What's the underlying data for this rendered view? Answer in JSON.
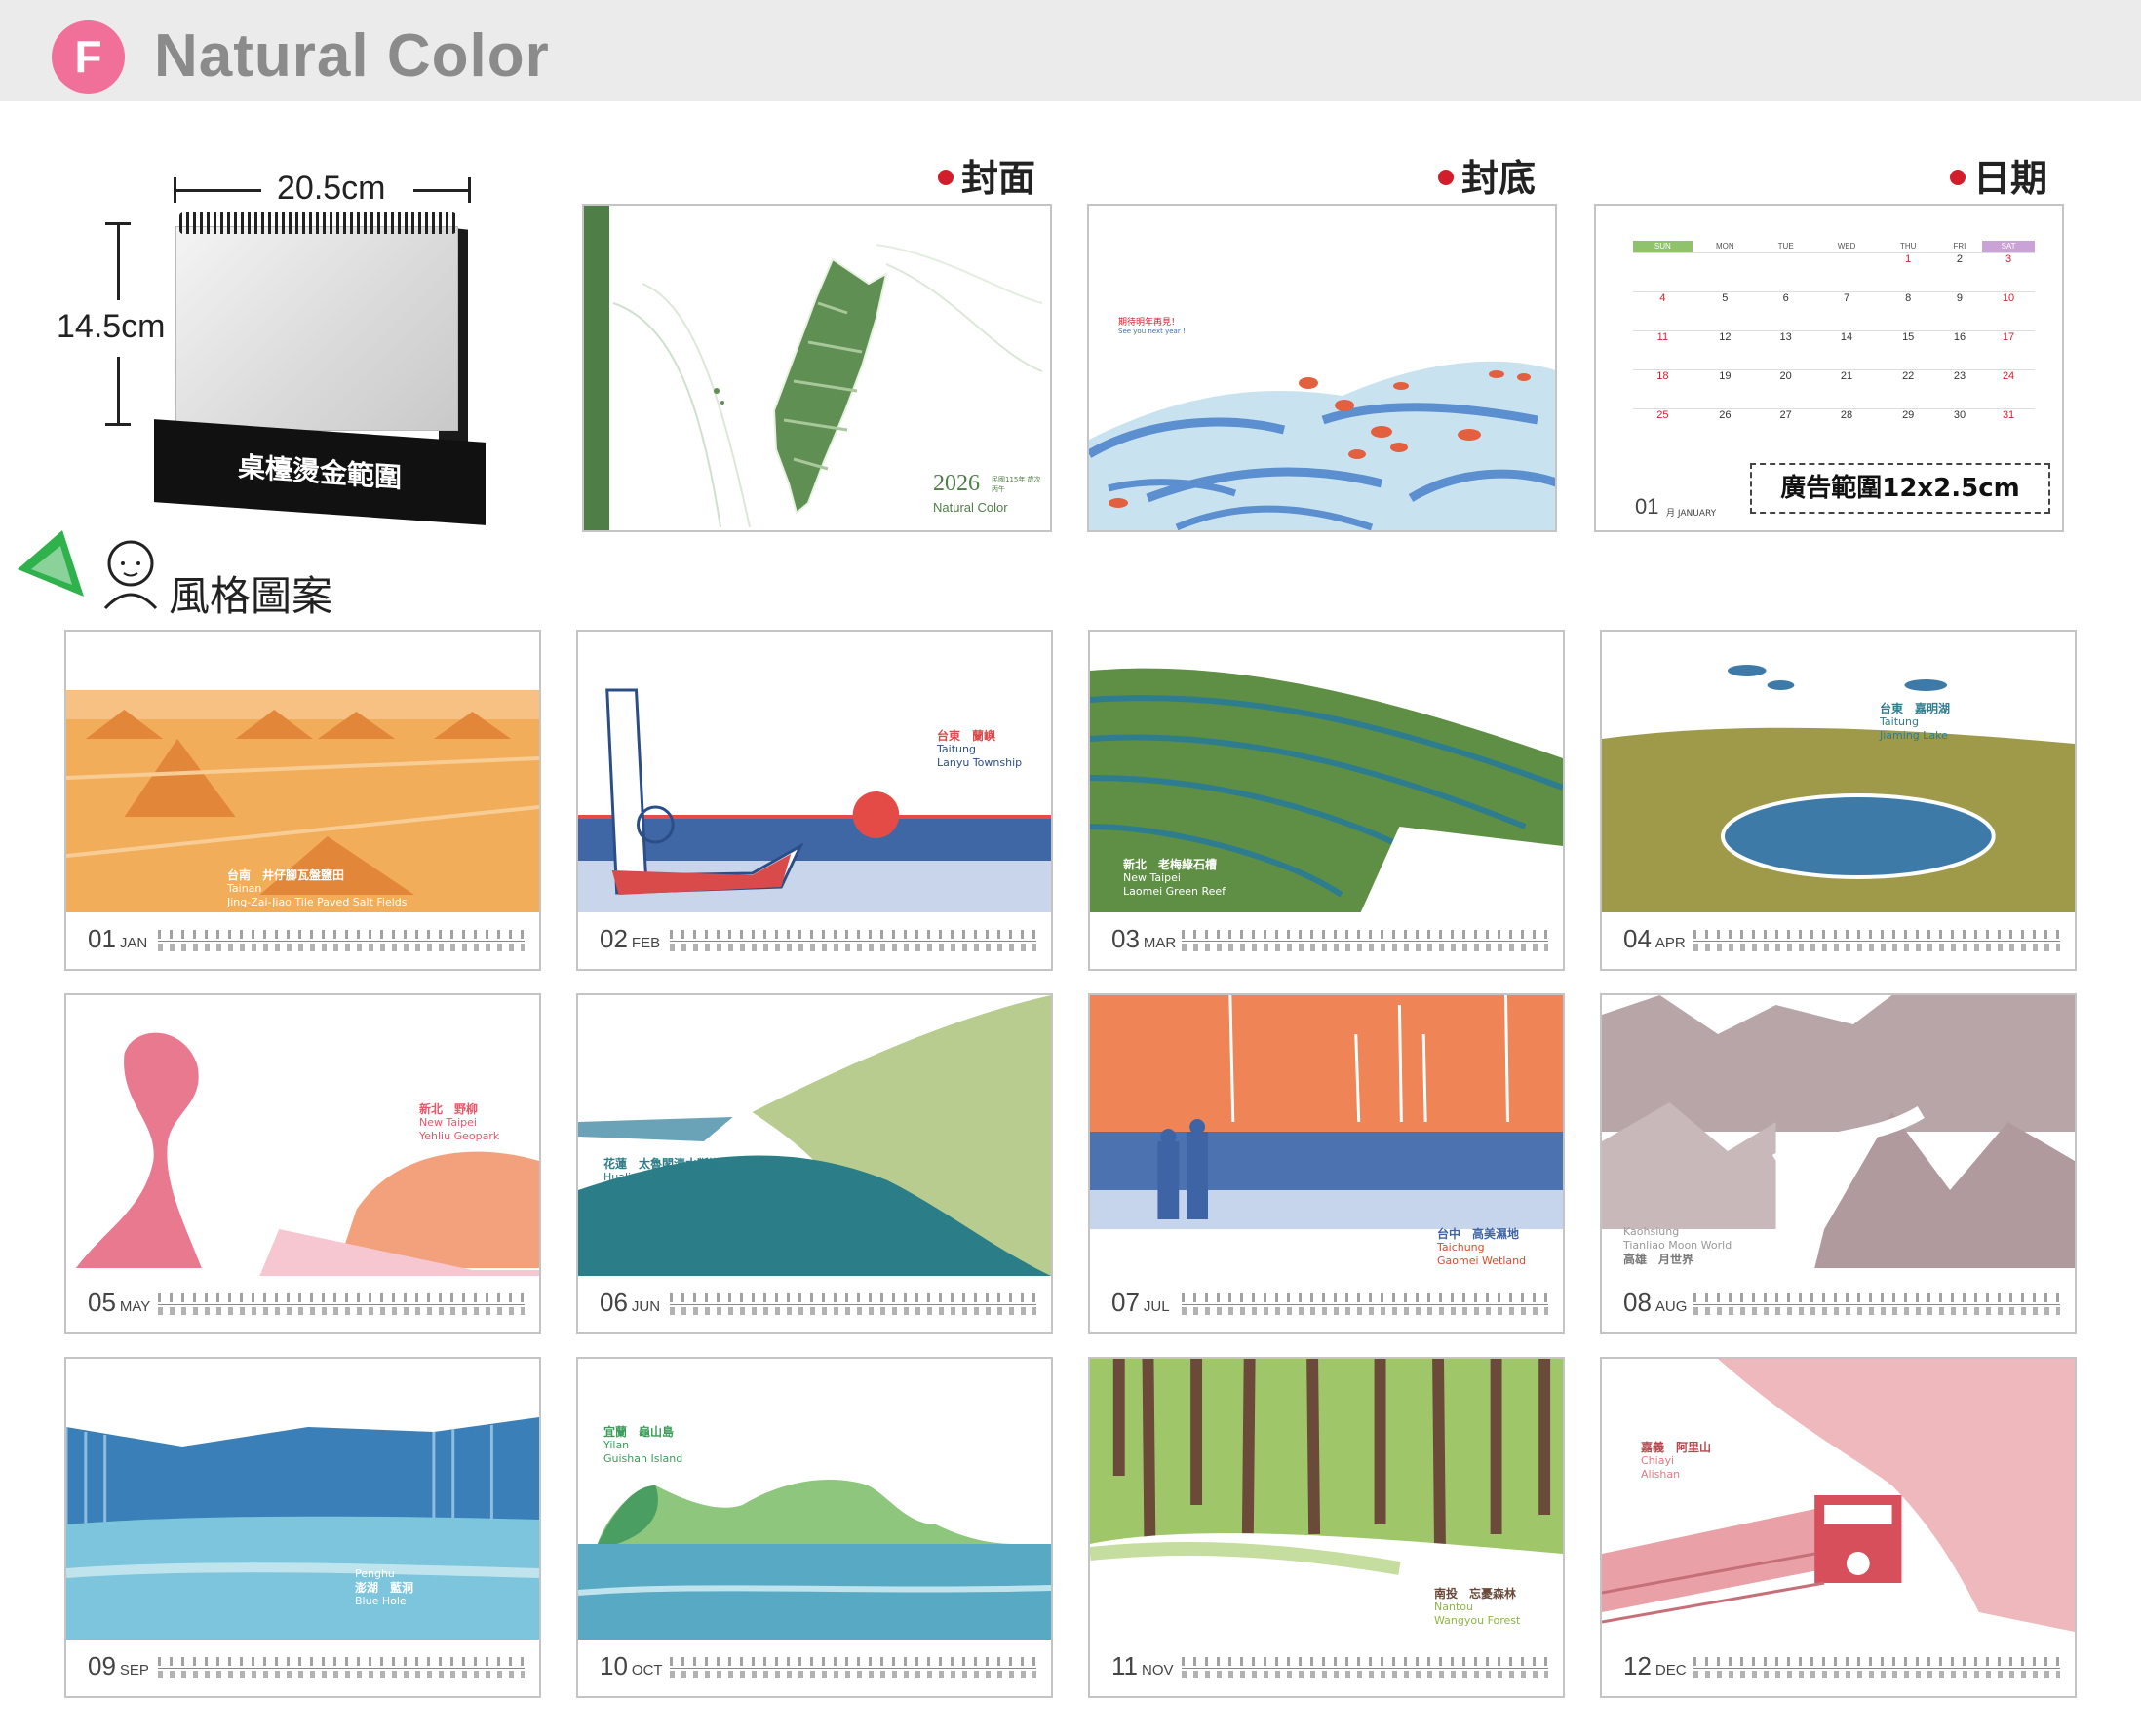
{
  "header": {
    "badge": "F",
    "title": "Natural Color"
  },
  "product": {
    "width_label": "20.5cm",
    "height_label": "14.5cm",
    "base_label": "桌檯燙金範圍"
  },
  "sections": {
    "cover": "封面",
    "back": "封底",
    "date": "日期",
    "style": "風格圖案"
  },
  "cover_preview": {
    "year": "2026",
    "roc": "民國115年 歲次丙午",
    "brand": "Natural Color"
  },
  "back_preview": {
    "zh": "期待明年再見！",
    "en": "See you next year !"
  },
  "date_preview": {
    "weekdays": [
      "SUN",
      "MON",
      "TUE",
      "WED",
      "THU",
      "FRI",
      "SAT"
    ],
    "rows": [
      [
        "",
        "",
        "",
        "",
        "1",
        "2",
        "3"
      ],
      [
        "4",
        "5",
        "6",
        "7",
        "8",
        "9",
        "10"
      ],
      [
        "11",
        "12",
        "13",
        "14",
        "15",
        "16",
        "17"
      ],
      [
        "18",
        "19",
        "20",
        "21",
        "22",
        "23",
        "24"
      ],
      [
        "25",
        "26",
        "27",
        "28",
        "29",
        "30",
        "31"
      ]
    ],
    "month_num": "01",
    "month_label": "月 JANUARY",
    "ad_area": "廣告範圍12x2.5cm"
  },
  "months": [
    {
      "num": "01",
      "abbr": "JAN",
      "zh": "台南　井仔腳瓦盤鹽田",
      "en1": "Tainan",
      "en2": "Jing-Zai-Jiao Tile Paved Salt Fields"
    },
    {
      "num": "02",
      "abbr": "FEB",
      "zh": "台東　蘭嶼",
      "en1": "Taitung",
      "en2": "Lanyu Township"
    },
    {
      "num": "03",
      "abbr": "MAR",
      "zh": "新北　老梅綠石槽",
      "en1": "New Taipei",
      "en2": "Laomei Green Reef"
    },
    {
      "num": "04",
      "abbr": "APR",
      "zh": "台東　嘉明湖",
      "en1": "Taitung",
      "en2": "Jiaming Lake"
    },
    {
      "num": "05",
      "abbr": "MAY",
      "zh": "新北　野柳",
      "en1": "New Taipei",
      "en2": "Yehliu Geopark"
    },
    {
      "num": "06",
      "abbr": "JUN",
      "zh": "花蓮　太魯閣清水斷崖",
      "en1": "Hualien",
      "en2": "Qingshui Cliff"
    },
    {
      "num": "07",
      "abbr": "JUL",
      "zh": "台中　高美濕地",
      "en1": "Taichung",
      "en2": "Gaomei Wetland"
    },
    {
      "num": "08",
      "abbr": "AUG",
      "zh": "高雄　月世界",
      "en1": "Kaohsiung",
      "en2": "Tianliao Moon World"
    },
    {
      "num": "09",
      "abbr": "SEP",
      "zh": "澎湖　藍洞",
      "en1": "Penghu",
      "en2": "Blue Hole"
    },
    {
      "num": "10",
      "abbr": "OCT",
      "zh": "宜蘭　龜山島",
      "en1": "Yilan",
      "en2": "Guishan Island"
    },
    {
      "num": "11",
      "abbr": "NOV",
      "zh": "南投　忘憂森林",
      "en1": "Nantou",
      "en2": "Wangyou Forest"
    },
    {
      "num": "12",
      "abbr": "DEC",
      "zh": "嘉義　阿里山",
      "en1": "Chiayi",
      "en2": "Alishan"
    }
  ],
  "colors": {
    "badge": "#f0709a",
    "header_bg": "#ebebeb",
    "title": "#8b8b8b",
    "accent_red": "#d21e2b",
    "sun": "#8fc26b",
    "sat": "#c9a3d6"
  }
}
